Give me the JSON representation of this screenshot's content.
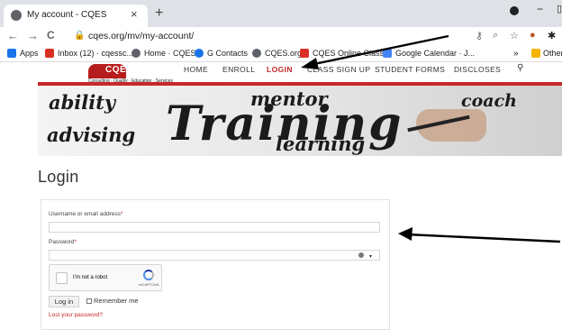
{
  "browser": {
    "tab_title": "My account - CQES",
    "tab_close": "×",
    "new_tab": "+",
    "back": "←",
    "forward": "→",
    "reload": "C",
    "url": "cqes.org/mv/my-account/",
    "bookmarks": [
      {
        "label": "Apps",
        "color": "#1a73e8"
      },
      {
        "label": "Inbox (12) · cqessc...",
        "color": "#d93025"
      },
      {
        "label": "Home · CQES",
        "color": "#5f6368"
      },
      {
        "label": "G Contacts",
        "color": "#1a73e8"
      },
      {
        "label": "CQES.org",
        "color": "#5f6368"
      },
      {
        "label": "CQES Online Classes",
        "color": "#d93025"
      },
      {
        "label": "Google Calendar · J...",
        "color": "#4285f4"
      }
    ],
    "bookmarks_more": "»",
    "other_bookmarks": "Other"
  },
  "site": {
    "logo_text": "CQES",
    "logo_tagline": "Consulting · Quality · Education · Services",
    "nav": [
      "HOME",
      "ENROLL",
      "LOGIN",
      "CLASS SIGN UP",
      "STUDENT FORMS",
      "DISCLOSES"
    ],
    "nav_active": "LOGIN",
    "search_icon": "search-icon",
    "accent_color": "#c62828"
  },
  "banner": {
    "words": [
      "ability",
      "mentor",
      "coach",
      "Training",
      "advising",
      "learning"
    ]
  },
  "login": {
    "title": "Login",
    "username_label": "Username or email address",
    "password_label": "Password",
    "required_mark": "*",
    "captcha_label": "I'm not a robot",
    "captcha_brand": "reCAPTCHA",
    "login_button": "Log in",
    "remember_label": "Remember me",
    "lost_password": "Lost your password?"
  }
}
